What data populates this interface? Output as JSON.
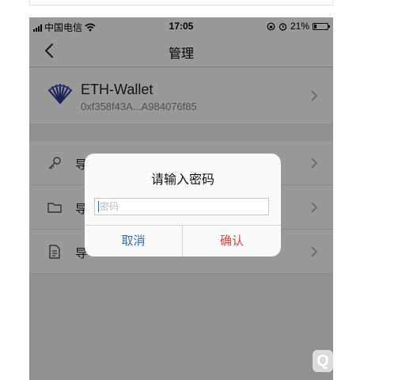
{
  "status_bar": {
    "carrier": "中国电信",
    "time": "17:05",
    "battery": "21%",
    "battery_level": 0.21
  },
  "nav": {
    "title": "管理"
  },
  "wallet": {
    "name": "ETH-Wallet",
    "address": "0xf358f43A...A984076f85"
  },
  "menu": {
    "items": [
      {
        "label": "导",
        "icon": "key-icon"
      },
      {
        "label": "导",
        "icon": "folder-icon"
      },
      {
        "label": "导",
        "icon": "document-icon"
      }
    ]
  },
  "dialog": {
    "title": "请输入密码",
    "input_placeholder": "密码",
    "input_value": "",
    "cancel_label": "取消",
    "confirm_label": "确认"
  },
  "colors": {
    "cancel": "#2a6fd6",
    "confirm": "#e0443a",
    "overlay": "rgba(0,0,0,0.4)"
  }
}
